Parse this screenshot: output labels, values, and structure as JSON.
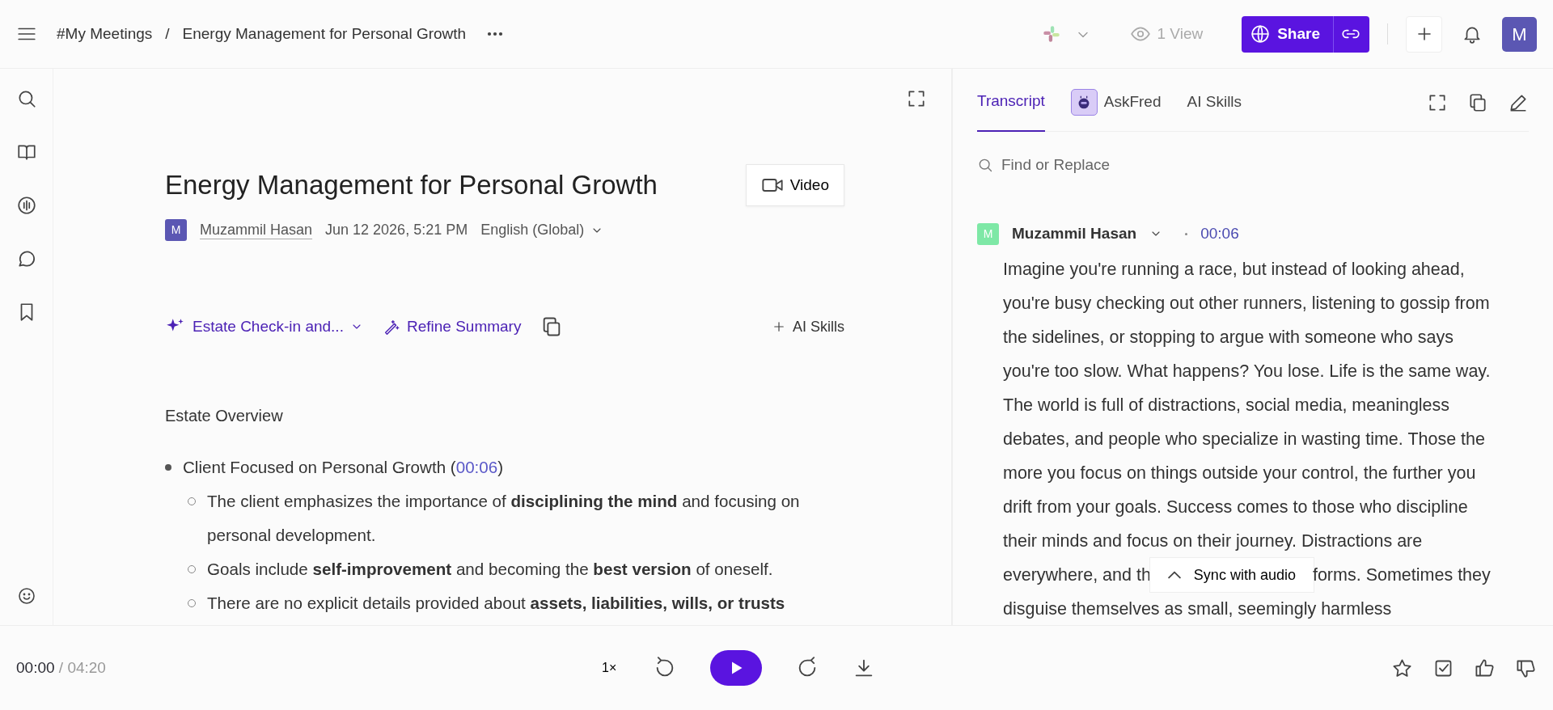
{
  "header": {
    "breadcrumb": [
      {
        "label": "#My Meetings"
      },
      {
        "label": "Energy Management for Personal Growth"
      }
    ],
    "separator": "/",
    "views": "1 View",
    "share_label": "Share",
    "avatar": "M"
  },
  "notes": {
    "title": "Energy Management for Personal Growth",
    "video_label": "Video",
    "author_initial": "M",
    "author": "Muzammil Hasan",
    "date": "Jun 12 2026, 5:21 PM",
    "language": "English (Global)",
    "template": "Estate Check-in and...",
    "refine": "Refine Summary",
    "ai_skills": "AI Skills",
    "section": "Estate Overview",
    "bullets": [
      {
        "text": "Client Focused on Personal Growth (",
        "time": "00:06",
        "close": ")",
        "children": [
          {
            "text": "The client emphasizes the importance of **disciplining the mind** and focusing on personal development."
          },
          {
            "text": "Goals include **self-improvement** and becoming the **best version** of oneself."
          },
          {
            "text": "There are no explicit details provided about **assets, liabilities, wills, or trusts**"
          }
        ]
      }
    ]
  },
  "transcript": {
    "tabs": [
      {
        "label": "Transcript",
        "selected": true,
        "kind": "text"
      },
      {
        "label": "AskFred",
        "selected": false,
        "kind": "bot"
      },
      {
        "label": "AI Skills",
        "selected": false,
        "kind": "text"
      }
    ],
    "search": {
      "placeholder": "Find or Replace"
    },
    "speaker": {
      "initial": "M",
      "name": "Muzammil Hasan",
      "time": "00:06"
    },
    "lines": [
      {
        "text": "Imagine you're running a race, but instead of looking ahead,"
      },
      {
        "text": "you're busy checking out other runners, listening to gossip from"
      },
      {
        "text": "the sidelines, or stopping to argue with someone who says"
      },
      {
        "text": "you're too slow. What happens? You lose. Life is the same way."
      },
      {
        "text": "The world is full of distractions, social media, meaningless"
      },
      {
        "text": "debates, and people who specialize in wasting time. Those the"
      },
      {
        "text": "more you focus on things outside your control, the further you"
      },
      {
        "text": "drift from your goals. Success comes to those who discipline"
      },
      {
        "text": "their minds and focus on their journey. Distractions are"
      },
      {
        "text": "everywhere, and th",
        "after": "forms. Sometimes they"
      },
      {
        "text": "disguise themselves as small, seemingly harmless"
      }
    ],
    "sync_label": "Sync with audio"
  },
  "player": {
    "current": "00:00",
    "duration": "/ 04:20",
    "speed": "1×"
  }
}
